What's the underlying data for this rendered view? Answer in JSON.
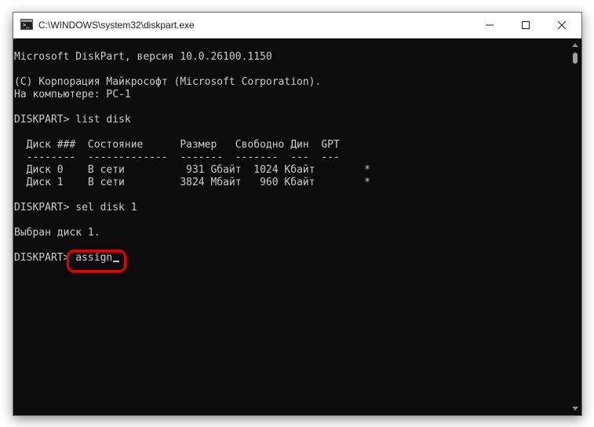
{
  "window": {
    "title": "C:\\WINDOWS\\system32\\diskpart.exe",
    "icon": "console-icon",
    "controls": [
      "minimize-icon",
      "maximize-icon",
      "close-icon"
    ]
  },
  "console": {
    "lines": [
      "Microsoft DiskPart, версия 10.0.26100.1150",
      "",
      "(C) Корпорация Майкрософт (Microsoft Corporation).",
      "На компьютере: PC-1",
      "",
      "DISKPART> list disk",
      "",
      "  Диск ###  Состояние      Размер   Свободно Дин  GPT",
      "  --------  -------------  -------  -------  ---  ---",
      "  Диск 0    В сети          931 Gбайт  1024 Кбайт        *",
      "  Диск 1    В сети         3824 Мбайт   960 Кбайт        *",
      "",
      "DISKPART> sel disk 1",
      "",
      "Выбран диск 1.",
      "",
      "DISKPART> assign"
    ],
    "highlight_color": "#e60000",
    "text_color": "#cccccc",
    "background_color": "#0c0c0c"
  }
}
